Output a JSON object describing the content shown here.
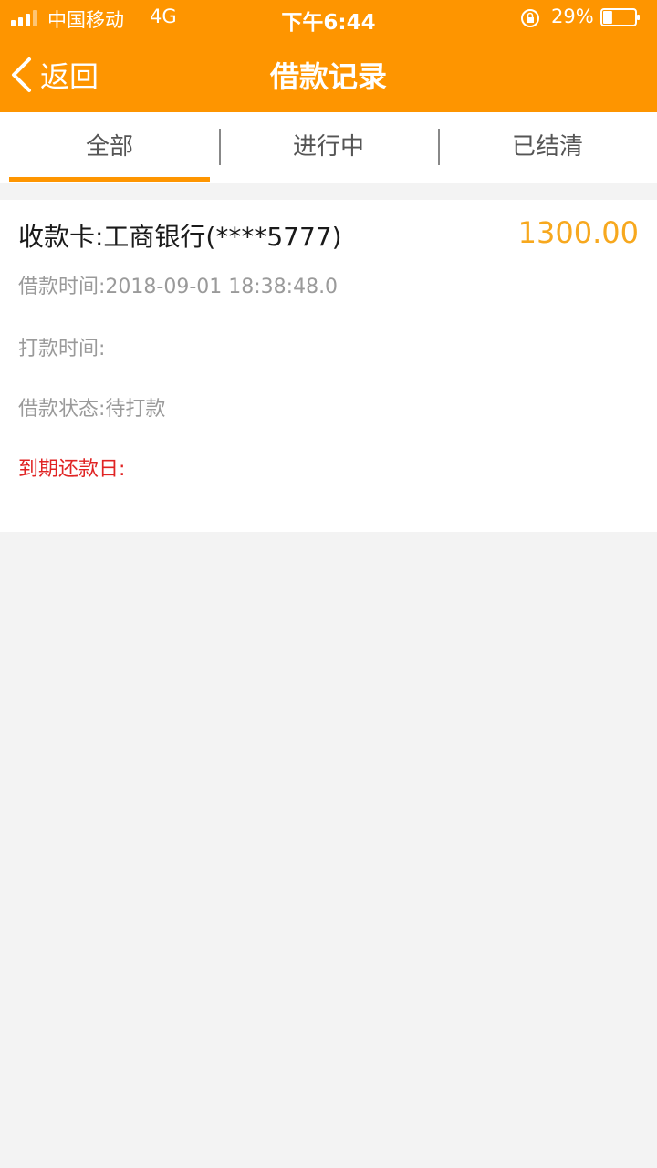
{
  "status_bar": {
    "carrier": "中国移动",
    "network": "4G",
    "time": "下午6:44",
    "battery_percent": "29%",
    "battery_level": 0.29,
    "signal_bars": 3,
    "signal_bars_total": 4
  },
  "nav": {
    "back_label": "返回",
    "title": "借款记录",
    "accent_color": "#fe9500"
  },
  "tabs": [
    {
      "label": "全部",
      "active": true
    },
    {
      "label": "进行中",
      "active": false
    },
    {
      "label": "已结清",
      "active": false
    }
  ],
  "record": {
    "card_label": "收款卡:工商银行(****5777)",
    "amount": "1300.00",
    "amount_color": "#f7a81e",
    "borrow_time": "借款时间:2018-09-01 18:38:48.0",
    "pay_time": "打款时间:",
    "status": "借款状态:待打款",
    "due_date": "到期还款日:",
    "due_color": "#e02424"
  }
}
